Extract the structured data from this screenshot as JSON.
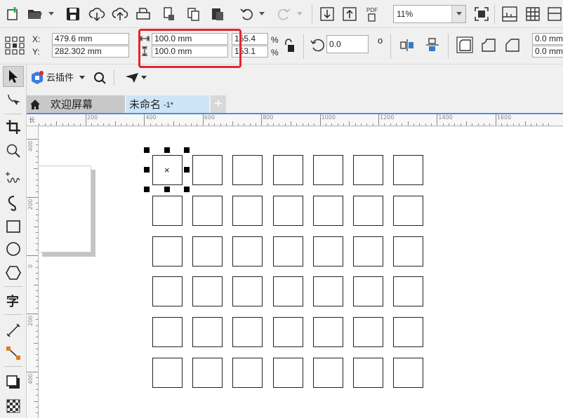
{
  "toolbar": {
    "new_doc": "new-document",
    "open": "open-folder",
    "save": "save",
    "zoom_level": "11%"
  },
  "property_bar": {
    "x_label": "X:",
    "y_label": "Y:",
    "x_value": "479.6 mm",
    "y_value": "282.302 mm",
    "width_value": "100.0 mm",
    "height_value": "100.0 mm",
    "scale_w": "155.4",
    "scale_h": "153.1",
    "percent_symbol": "%",
    "rotation_value": "0.0",
    "degree_symbol": "o",
    "corner_a": "0.0 mm",
    "corner_b": "0.0 mm"
  },
  "row3": {
    "cloud_plugin_label": "云插件"
  },
  "tabs": {
    "welcome": "欢迎屏幕",
    "document": "未命名",
    "document_suffix": "-1*",
    "add": "+"
  },
  "ruler": {
    "top_labels": [
      "200",
      "400",
      "600",
      "800",
      "1000",
      "1200",
      "1400",
      "1600"
    ],
    "left_labels": [
      "400",
      "200",
      "0",
      "200",
      "400"
    ],
    "origin_mark": "长"
  },
  "canvas": {
    "selected_marker": "×",
    "grid_rows": 6,
    "grid_cols": 7
  },
  "colors": {
    "highlight": "#e3262b",
    "tab_active": "#cde4f7",
    "accent": "#4a90d9"
  }
}
